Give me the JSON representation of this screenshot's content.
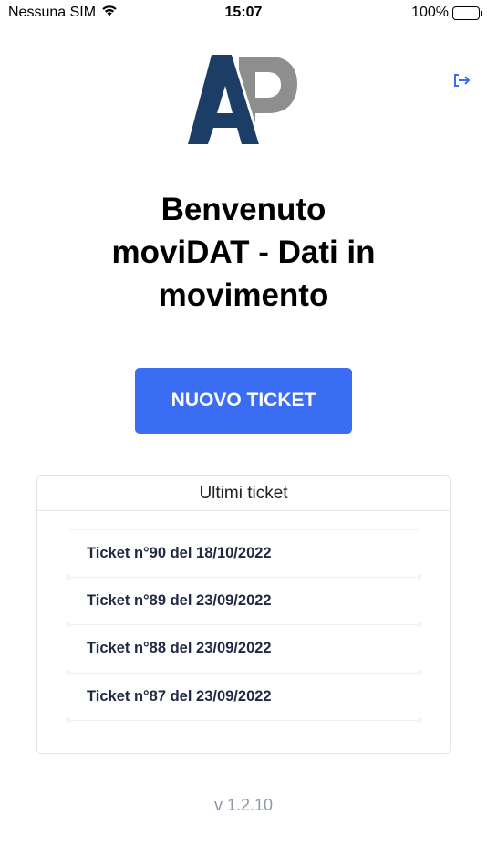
{
  "status_bar": {
    "carrier": "Nessuna SIM",
    "time": "15:07",
    "battery": "100%"
  },
  "header": {
    "logo_letters": "AP",
    "logout_icon": "logout-icon"
  },
  "welcome": {
    "line1": "Benvenuto",
    "line2": "moviDAT - Dati in",
    "line3": "movimento"
  },
  "actions": {
    "new_ticket_label": "NUOVO TICKET"
  },
  "recent_tickets": {
    "title": "Ultimi ticket",
    "items": [
      {
        "label": "Ticket n°90 del 18/10/2022"
      },
      {
        "label": "Ticket n°89 del 23/09/2022"
      },
      {
        "label": "Ticket n°88 del 23/09/2022"
      },
      {
        "label": "Ticket n°87 del 23/09/2022"
      }
    ]
  },
  "footer": {
    "version": "v 1.2.10"
  },
  "colors": {
    "primary": "#3a6cf4",
    "logo_dark": "#1c3d66",
    "logo_gray": "#8e8e8e",
    "version_text": "#8d97a8"
  }
}
